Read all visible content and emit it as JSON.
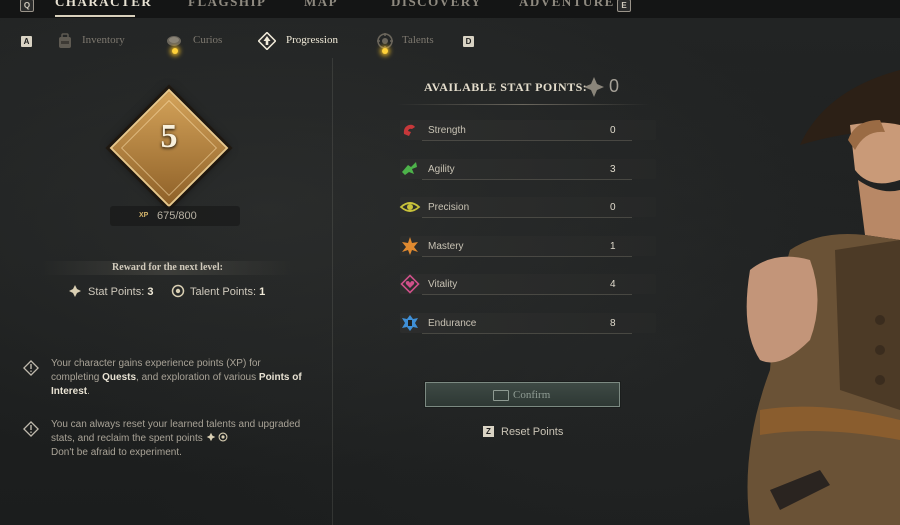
{
  "top_nav": {
    "key_left": "Q",
    "items": [
      "CHARACTER",
      "FLAGSHIP",
      "MAP",
      "DISCOVERY",
      "ADVENTURE"
    ],
    "key_right": "E"
  },
  "sub_nav": {
    "key_left": "A",
    "tabs": [
      "Inventory",
      "Curios",
      "Progression",
      "Talents"
    ],
    "key_right": "D"
  },
  "level": {
    "value": "5",
    "xp_label": "XP",
    "xp_text": "675/800",
    "reward_title": "Reward for the next level:",
    "stat_points_label": "Stat Points:",
    "stat_points_value": "3",
    "talent_points_label": "Talent Points:",
    "talent_points_value": "1"
  },
  "tips": [
    {
      "pre": "Your character gains experience points (XP) for completing ",
      "b1": "Quests",
      "mid": ", and exploration of various ",
      "b2": "Points of Interest",
      "post": "."
    },
    {
      "line1": "You can always reset your learned talents and upgraded stats, and reclaim the spent points",
      "line2": "Don't be afraid to experiment."
    }
  ],
  "stats": {
    "available_title": "AVAILABLE STAT POINTS:",
    "available_value": "0",
    "items": [
      {
        "name": "Strength",
        "value": "0",
        "icon": "strength-icon",
        "color": "#c8383a"
      },
      {
        "name": "Agility",
        "value": "3",
        "icon": "agility-icon",
        "color": "#4db34a"
      },
      {
        "name": "Precision",
        "value": "0",
        "icon": "precision-icon",
        "color": "#c8c23a"
      },
      {
        "name": "Mastery",
        "value": "1",
        "icon": "mastery-icon",
        "color": "#e08a30"
      },
      {
        "name": "Vitality",
        "value": "4",
        "icon": "vitality-icon",
        "color": "#d0508a"
      },
      {
        "name": "Endurance",
        "value": "8",
        "icon": "endurance-icon",
        "color": "#3f8fd6"
      }
    ]
  },
  "actions": {
    "confirm_label": "Confirm",
    "reset_key": "Z",
    "reset_label": "Reset Points"
  }
}
